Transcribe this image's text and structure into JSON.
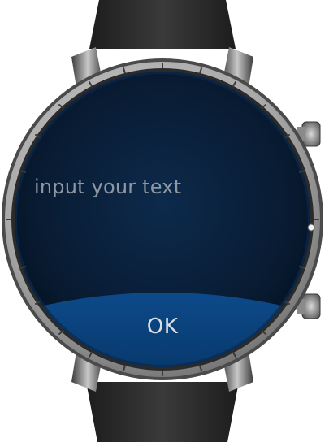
{
  "input": {
    "placeholder": "input your text"
  },
  "actions": {
    "ok_label": "OK"
  },
  "colors": {
    "screen_background": "#0c2340",
    "bottom_panel": "#0a3f7a",
    "placeholder_text": "#8f98a2",
    "ok_text": "#d8dde2",
    "bezel": "#9a9a9a",
    "strap": "#2b2b2b"
  },
  "icons": {
    "bezel": "watch-bezel-icon",
    "crown_top": "crown-button-icon",
    "crown_bottom": "crown-button-icon"
  }
}
